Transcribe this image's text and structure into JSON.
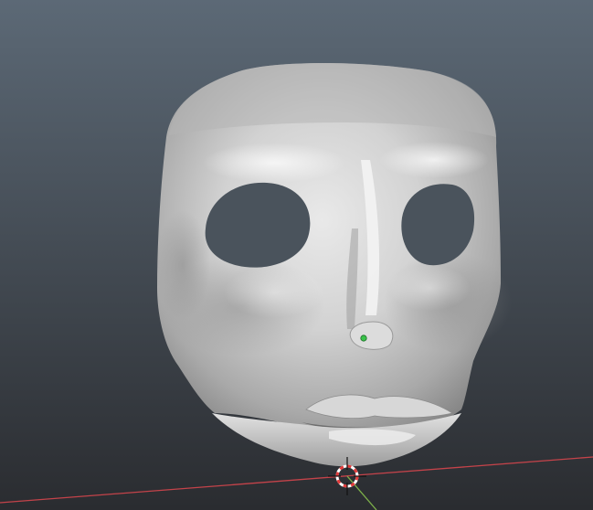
{
  "viewport": {
    "background_top": "#5b6875",
    "background_bottom": "#2b2d31",
    "mesh_base": "#c9c9c9",
    "mesh_highlight": "#f0f0f0",
    "mesh_shadow": "#7d7d7d",
    "axis_x_color": "#c8444a",
    "axis_y_color": "#7fb24c"
  },
  "scene_objects": [
    {
      "name": "sculpted-face-mask",
      "type": "mesh"
    },
    {
      "name": "object-origin",
      "type": "origin-point",
      "color": "#39c24a"
    },
    {
      "name": "3d-cursor",
      "type": "cursor",
      "ring_colors": [
        "#ffffff",
        "#e23b3b"
      ]
    }
  ]
}
